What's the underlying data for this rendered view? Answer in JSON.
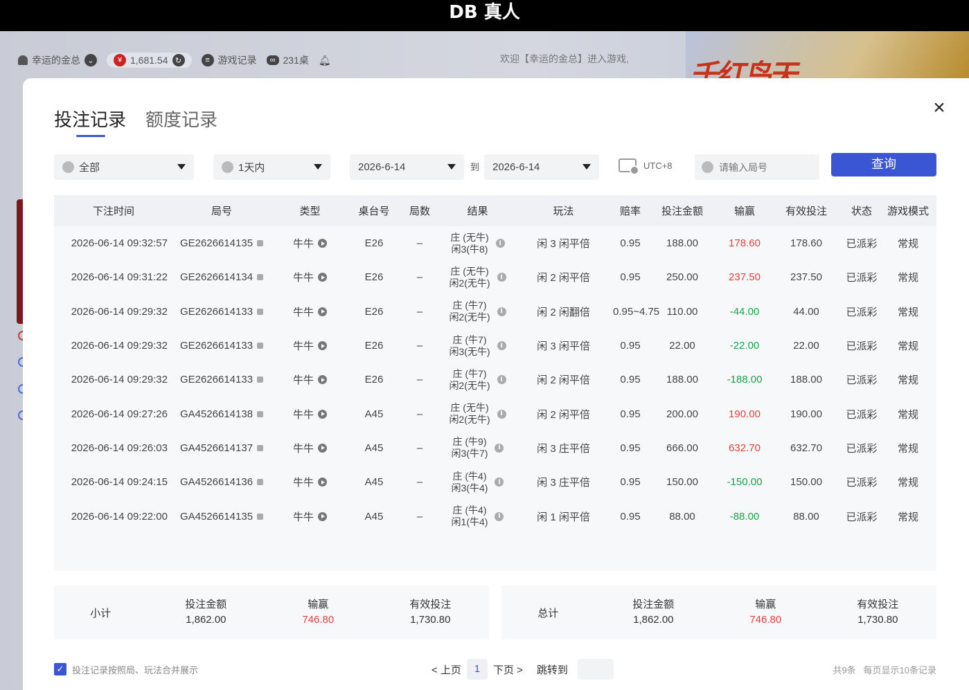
{
  "window": {
    "title": "DB 真人"
  },
  "topbar": {
    "username": "幸运的金总",
    "balance": "1,681.54",
    "game_records": "游戏记录",
    "tables": "231桌",
    "welcome": "欢迎【幸运的金总】进入游戏,",
    "banner_text": "千红鸟天"
  },
  "modal": {
    "tabs": [
      "投注记录",
      "额度记录"
    ],
    "close": "×",
    "filters": {
      "category": "全部",
      "period": "1天内",
      "date_from": "2026-6-14",
      "to": "到",
      "date_to": "2026-6-14",
      "timezone": "UTC+8",
      "round_placeholder": "请输入局号",
      "query": "查询"
    },
    "columns": [
      "下注时间",
      "局号",
      "类型",
      "桌台号",
      "局数",
      "结果",
      "玩法",
      "赔率",
      "投注金额",
      "输赢",
      "有效投注",
      "状态",
      "游戏模式"
    ],
    "rows": [
      {
        "time": "2026-06-14 09:32:57",
        "round": "GE2626614135",
        "type": "牛牛",
        "table": "E26",
        "count": "–",
        "r1": "庄 (无牛)",
        "r2": "闲3(牛8)",
        "play": "闲 3 闲平倍",
        "odds": "0.95",
        "bet": "188.00",
        "win": "178.60",
        "sign": "pos",
        "valid": "178.60",
        "status": "已派彩",
        "mode": "常规"
      },
      {
        "time": "2026-06-14 09:31:22",
        "round": "GE2626614134",
        "type": "牛牛",
        "table": "E26",
        "count": "–",
        "r1": "庄 (无牛)",
        "r2": "闲2(无牛)",
        "play": "闲 2 闲平倍",
        "odds": "0.95",
        "bet": "250.00",
        "win": "237.50",
        "sign": "pos",
        "valid": "237.50",
        "status": "已派彩",
        "mode": "常规"
      },
      {
        "time": "2026-06-14 09:29:32",
        "round": "GE2626614133",
        "type": "牛牛",
        "table": "E26",
        "count": "–",
        "r1": "庄 (牛7)",
        "r2": "闲2(无牛)",
        "play": "闲 2 闲翻倍",
        "odds": "0.95~4.75",
        "bet": "110.00",
        "win": "-44.00",
        "sign": "neg",
        "valid": "44.00",
        "status": "已派彩",
        "mode": "常规"
      },
      {
        "time": "2026-06-14 09:29:32",
        "round": "GE2626614133",
        "type": "牛牛",
        "table": "E26",
        "count": "–",
        "r1": "庄 (牛7)",
        "r2": "闲3(无牛)",
        "play": "闲 3 闲平倍",
        "odds": "0.95",
        "bet": "22.00",
        "win": "-22.00",
        "sign": "neg",
        "valid": "22.00",
        "status": "已派彩",
        "mode": "常规"
      },
      {
        "time": "2026-06-14 09:29:32",
        "round": "GE2626614133",
        "type": "牛牛",
        "table": "E26",
        "count": "–",
        "r1": "庄 (牛7)",
        "r2": "闲2(无牛)",
        "play": "闲 2 闲平倍",
        "odds": "0.95",
        "bet": "188.00",
        "win": "-188.00",
        "sign": "neg",
        "valid": "188.00",
        "status": "已派彩",
        "mode": "常规"
      },
      {
        "time": "2026-06-14 09:27:26",
        "round": "GA4526614138",
        "type": "牛牛",
        "table": "A45",
        "count": "–",
        "r1": "庄 (无牛)",
        "r2": "闲2(无牛)",
        "play": "闲 2 闲平倍",
        "odds": "0.95",
        "bet": "200.00",
        "win": "190.00",
        "sign": "pos",
        "valid": "190.00",
        "status": "已派彩",
        "mode": "常规"
      },
      {
        "time": "2026-06-14 09:26:03",
        "round": "GA4526614137",
        "type": "牛牛",
        "table": "A45",
        "count": "–",
        "r1": "庄 (牛9)",
        "r2": "闲3(牛7)",
        "play": "闲 3 庄平倍",
        "odds": "0.95",
        "bet": "666.00",
        "win": "632.70",
        "sign": "pos",
        "valid": "632.70",
        "status": "已派彩",
        "mode": "常规"
      },
      {
        "time": "2026-06-14 09:24:15",
        "round": "GA4526614136",
        "type": "牛牛",
        "table": "A45",
        "count": "–",
        "r1": "庄 (牛4)",
        "r2": "闲3(牛4)",
        "play": "闲 3 庄平倍",
        "odds": "0.95",
        "bet": "150.00",
        "win": "-150.00",
        "sign": "neg",
        "valid": "150.00",
        "status": "已派彩",
        "mode": "常规"
      },
      {
        "time": "2026-06-14 09:22:00",
        "round": "GA4526614135",
        "type": "牛牛",
        "table": "A45",
        "count": "–",
        "r1": "庄 (牛4)",
        "r2": "闲1(牛4)",
        "play": "闲 1 闲平倍",
        "odds": "0.95",
        "bet": "88.00",
        "win": "-88.00",
        "sign": "neg",
        "valid": "88.00",
        "status": "已派彩",
        "mode": "常规"
      }
    ],
    "subtotal": {
      "label": "小计",
      "bet_label": "投注金额",
      "bet": "1,862.00",
      "win_label": "输赢",
      "win": "746.80",
      "valid_label": "有效投注",
      "valid": "1,730.80"
    },
    "total": {
      "label": "总计",
      "bet_label": "投注金额",
      "bet": "1,862.00",
      "win_label": "输赢",
      "win": "746.80",
      "valid_label": "有效投注",
      "valid": "1,730.80"
    },
    "footer": {
      "merge_label": "投注记录按照局、玩法合并展示",
      "prev": "< 上页",
      "page": "1",
      "next": "下页 >",
      "jump": "跳转到",
      "count": "共9条",
      "per_page": "每页显示10条记录"
    }
  },
  "colors": {
    "accent": "#3a56d4",
    "win": "#e0403c",
    "loss": "#16a34a"
  }
}
